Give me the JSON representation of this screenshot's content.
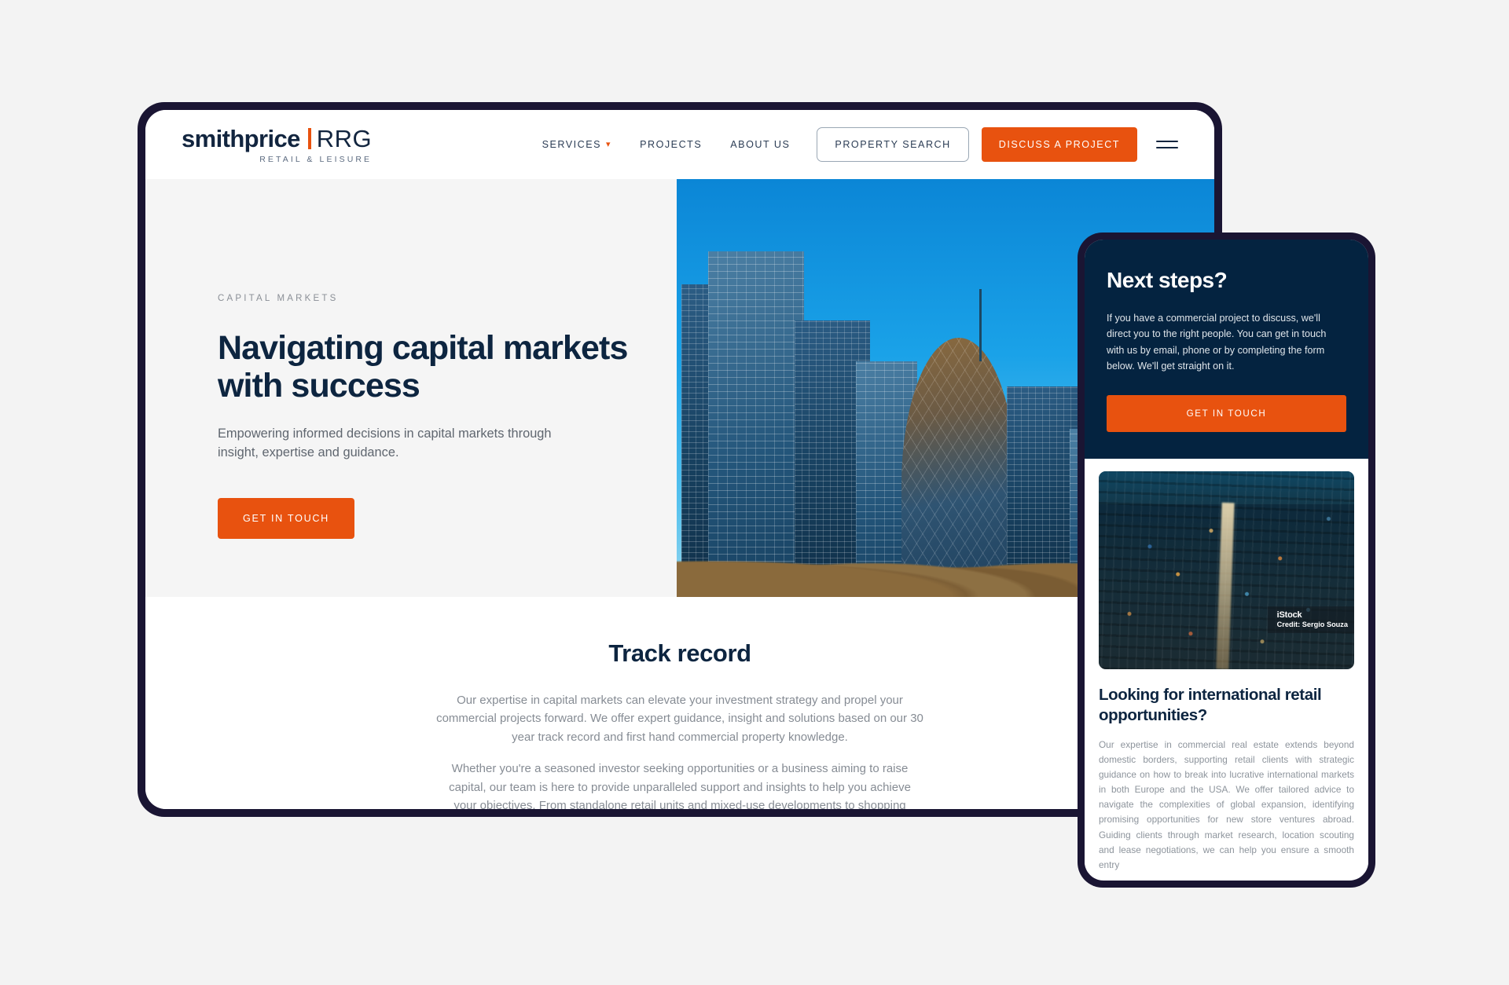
{
  "colors": {
    "frame": "#1a1533",
    "navy": "#0d2540",
    "orange": "#e8520f",
    "panel_navy": "#042340",
    "page_bg": "#f3f3f3"
  },
  "desktop": {
    "header": {
      "logo": {
        "word": "smithprice",
        "divider": "vertical-bar",
        "rrg": "RRG",
        "tagline": "RETAIL & LEISURE"
      },
      "nav": [
        {
          "label": "SERVICES",
          "has_dropdown": true
        },
        {
          "label": "PROJECTS",
          "has_dropdown": false
        },
        {
          "label": "ABOUT US",
          "has_dropdown": false
        }
      ],
      "property_search_label": "PROPERTY SEARCH",
      "discuss_label": "DISCUSS A PROJECT",
      "menu_icon": "hamburger-icon"
    },
    "hero": {
      "eyebrow": "CAPITAL MARKETS",
      "title": "Navigating capital markets with success",
      "subtitle": "Empowering informed decisions in capital markets through insight, expertise and guidance.",
      "cta_label": "GET IN TOUCH",
      "image_alt": "London City skyline with the Gherkin and Tower Bridge spire"
    },
    "track_record": {
      "heading": "Track record",
      "paragraphs": [
        "Our expertise in capital markets can elevate your investment strategy and propel your commercial projects forward. We offer expert guidance, insight and solutions based on our 30 year track record and first hand commercial property knowledge.",
        "Whether you're a seasoned investor seeking opportunities or a business aiming to raise capital, our team is here to provide unparalleled support and insights to help you achieve your objectives. From standalone retail units and mixed-use developments to shopping centres or leisure parks, we specialise in identifying and executing asset"
      ]
    }
  },
  "mobile": {
    "next_steps": {
      "heading": "Next steps?",
      "body": "If you have a commercial project to discuss, we'll direct you to the right people. You can get in touch with us by email, phone or by completing the form below. We'll get straight on it.",
      "cta_label": "GET IN TOUCH"
    },
    "photo": {
      "alt": "Aerial night view of a dense city with a lit avenue",
      "credit_brand": "iStock",
      "credit_line": "Credit: Sergio Souza"
    },
    "article": {
      "heading": "Looking for international retail opportunities?",
      "body": "Our expertise in commercial real estate extends beyond domestic borders, supporting retail clients with strategic guidance on how to break into lucrative international markets in both Europe and the USA. We offer tailored advice to navigate the complexities of global expansion, identifying promising opportunities for new store ventures abroad. Guiding clients through market research, location scouting and lease negotiations, we can help you ensure a smooth entry"
    }
  }
}
